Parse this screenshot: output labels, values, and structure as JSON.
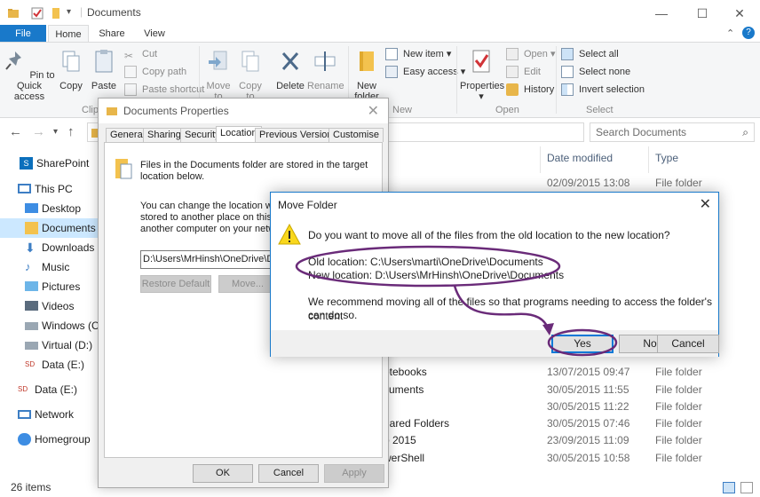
{
  "window": {
    "title": "Documents",
    "caption_minimize": "—",
    "caption_maximize": "☐",
    "caption_close": "✕"
  },
  "ribbon_tabs": [
    "File",
    "Home",
    "Share",
    "View"
  ],
  "ribbon": {
    "pin": "Pin to Quick access",
    "copy": "Copy",
    "paste": "Paste",
    "cut": "Cut",
    "copy_path": "Copy path",
    "paste_shortcut": "Paste shortcut",
    "clipboard_group": "Clipbo",
    "move_to": "Move to",
    "copy_to": "Copy to",
    "delete": "Delete",
    "rename": "Rename",
    "new_folder": "New folder",
    "new_item": "New item",
    "easy_access": "Easy access",
    "new_group": "New",
    "properties": "Properties",
    "open": "Open",
    "edit": "Edit",
    "history": "History",
    "open_group": "Open",
    "select_all": "Select all",
    "select_none": "Select none",
    "invert_selection": "Invert selection",
    "select_group": "Select"
  },
  "search": {
    "placeholder": "Search Documents"
  },
  "nav": [
    {
      "label": "SharePoint"
    },
    {
      "label": "This PC"
    },
    {
      "label": "Desktop"
    },
    {
      "label": "Documents"
    },
    {
      "label": "Downloads"
    },
    {
      "label": "Music"
    },
    {
      "label": "Pictures"
    },
    {
      "label": "Videos"
    },
    {
      "label": "Windows (C:)"
    },
    {
      "label": "Virtual (D:)"
    },
    {
      "label": "Data (E:)"
    },
    {
      "label": "Data (E:)"
    },
    {
      "label": "Network"
    },
    {
      "label": "Homegroup"
    }
  ],
  "columns": {
    "date": "Date modified",
    "type": "Type"
  },
  "files": [
    {
      "name": "",
      "date": "02/09/2015 13:08",
      "type": "File folder"
    },
    {
      "name": "otebooks",
      "date": "13/07/2015 09:47",
      "type": "File folder"
    },
    {
      "name": "cuments",
      "date": "30/05/2015 11:55",
      "type": "File folder"
    },
    {
      "name": "",
      "date": "30/05/2015 11:22",
      "type": "File folder"
    },
    {
      "name": "hared Folders",
      "date": "30/05/2015 07:46",
      "type": "File folder"
    },
    {
      "name": "o 2015",
      "date": "23/09/2015 11:09",
      "type": "File folder"
    },
    {
      "name": "werShell",
      "date": "30/05/2015 10:58",
      "type": "File folder"
    }
  ],
  "files_partial": {
    "type_below_dialog": "File folder"
  },
  "status": {
    "count": "26 items"
  },
  "properties_dialog": {
    "title": "Documents Properties",
    "tabs": [
      "General",
      "Sharing",
      "Security",
      "Location",
      "Previous Versions",
      "Customise"
    ],
    "info_line1": "Files in the Documents folder are stored in the target",
    "info_line2": "location below.",
    "change_line1": "You can change the location where",
    "change_line2": "stored to another place on this har",
    "change_line3": "another computer on your network.",
    "path": "D:\\Users\\MrHinsh\\OneDrive\\Documents",
    "restore_default": "Restore Default",
    "move": "Move...",
    "ok": "OK",
    "cancel": "Cancel",
    "apply": "Apply"
  },
  "move_dialog": {
    "title": "Move Folder",
    "question": "Do you want to move all of the files from the old location to the new location?",
    "old_location": "Old location: C:\\Users\\marti\\OneDrive\\Documents",
    "new_location": "New location: D:\\Users\\MrHinsh\\OneDrive\\Documents",
    "recommend_line1": "We recommend moving all of the files so that programs needing to access the folder's content",
    "recommend_line2": "can do so.",
    "yes": "Yes",
    "no": "No",
    "cancel": "Cancel"
  },
  "annotation_color": "#6a2b79"
}
